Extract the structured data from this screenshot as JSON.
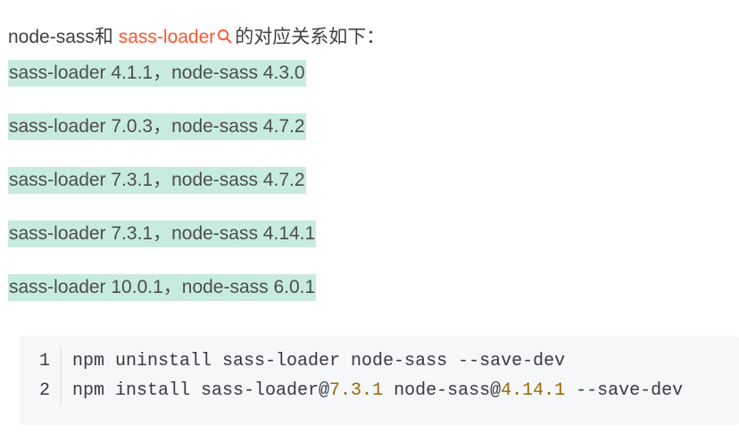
{
  "intro": {
    "prefix": "node-sass和",
    "link_text": "sass-loader",
    "suffix": "的对应关系如下："
  },
  "pairs": [
    "sass-loader 4.1.1，node-sass 4.3.0",
    "sass-loader 7.0.3，node-sass 4.7.2",
    "sass-loader 7.3.1，node-sass 4.7.2",
    "sass-loader 7.3.1，node-sass 4.14.1",
    "sass-loader 10.0.1，node-sass 6.0.1"
  ],
  "code": {
    "lines": [
      {
        "number": "1",
        "text": "npm uninstall sass-loader node-sass --save-dev"
      },
      {
        "number": "2",
        "part1": "npm install sass-loader@",
        "version1": "7.3.1",
        "part2": " node-sass@",
        "version2": "4.14.1",
        "part3": " --save-dev"
      }
    ]
  },
  "colors": {
    "link": "#fc5531",
    "highlight": "#c8ebe0",
    "code_background": "#f6f7f8",
    "version_number": "#986801"
  }
}
